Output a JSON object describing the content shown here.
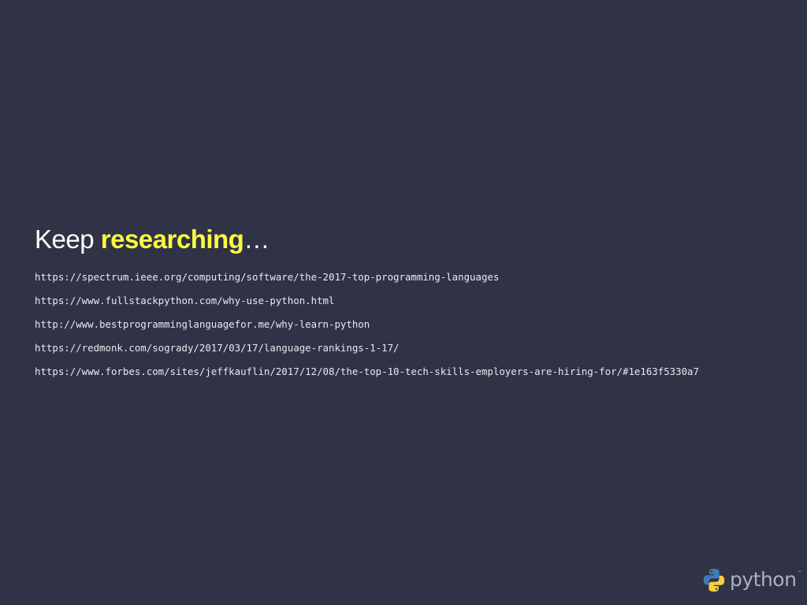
{
  "slide": {
    "heading": {
      "prefix": "Keep ",
      "accent": "researching",
      "suffix": "…"
    },
    "links": [
      "https://spectrum.ieee.org/computing/software/the-2017-top-programming-languages",
      "https://www.fullstackpython.com/why-use-python.html",
      "http://www.bestprogramminglanguagefor.me/why-learn-python",
      "https://redmonk.com/sogrady/2017/03/17/language-rankings-1-17/",
      "https://www.forbes.com/sites/jeffkauflin/2017/12/08/the-top-10-tech-skills-employers-are-hiring-for/#1e163f5330a7"
    ],
    "logo": {
      "icon": "python-logo-icon",
      "wordmark": "python",
      "trademark": "™"
    }
  },
  "colors": {
    "background": "#303346",
    "text": "#ffffff",
    "accent": "#fafa41",
    "link_text": "#e8e9ee",
    "logo_blue": "#3f7bb5",
    "logo_yellow": "#f5cf3f",
    "logo_wordmark": "#aeb0bb"
  }
}
